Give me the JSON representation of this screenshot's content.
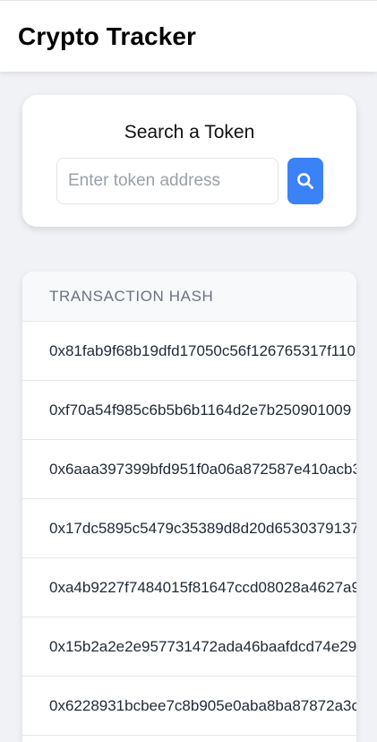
{
  "header": {
    "title": "Crypto Tracker"
  },
  "search": {
    "heading": "Search a Token",
    "placeholder": "Enter token address",
    "value": "",
    "button_icon": "search-icon",
    "button_color": "#3b82f6"
  },
  "table": {
    "column_header": "TRANSACTION HASH",
    "rows": [
      "0x81fab9f68b19dfd17050c56f126765317f110",
      "0xf70a54f985c6b5b6b1164d2e7b250901009",
      "0x6aaa397399bfd951f0a06a872587e410acb3",
      "0x17dc5895c5479c35389d8d20d6530379137",
      "0xa4b9227f7484015f81647ccd08028a4627a9",
      "0x15b2a2e2e957731472ada46baafdcd74e29",
      "0x6228931bcbee7c8b905e0aba8ba87872a3c"
    ]
  }
}
